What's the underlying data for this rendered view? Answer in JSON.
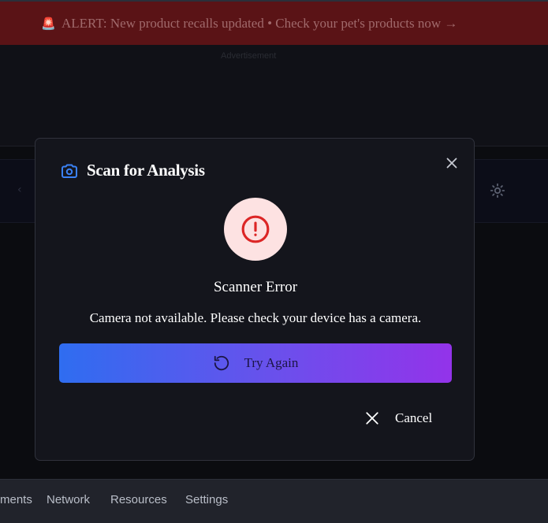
{
  "alert": {
    "emoji": "🚨",
    "text": "ALERT: New product recalls updated • Check your pet's products now →"
  },
  "ad": {
    "label": "Advertisement"
  },
  "devtools": {
    "tabs": [
      "ments",
      "Network",
      "Resources",
      "Settings"
    ]
  },
  "modal": {
    "title": "Scan for Analysis",
    "icons": {
      "title": "camera-icon",
      "close": "close-icon",
      "error": "alert-circle-icon",
      "retry": "rotate-ccw-icon",
      "cancel": "x-icon"
    },
    "error_title": "Scanner Error",
    "error_message": "Camera not available. Please check your device has a camera.",
    "try_again_label": "Try Again",
    "cancel_label": "Cancel"
  },
  "colors": {
    "accent_blue": "#3b82f6",
    "error_red": "#dc2626",
    "error_bg": "#fde2e2",
    "gradient_start": "#2f6df0",
    "gradient_end": "#9333ea"
  }
}
